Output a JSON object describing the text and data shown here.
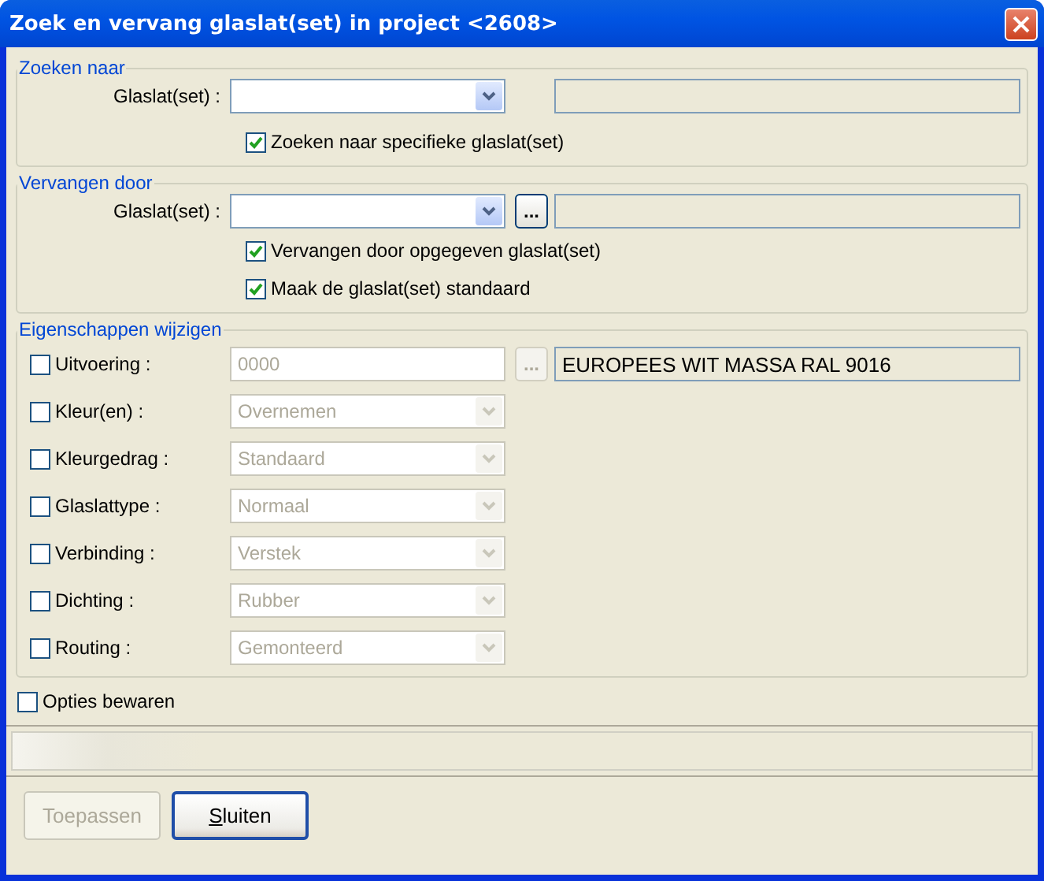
{
  "window": {
    "title": "Zoek en vervang glaslat(set) in project <2608>"
  },
  "search": {
    "legend": "Zoeken naar",
    "label": "Glaslat(set) :",
    "options": [
      {
        "label": "Zoeken naar specifieke glaslat(set)",
        "checked": true
      }
    ]
  },
  "replace": {
    "legend": "Vervangen door",
    "label": "Glaslat(set) :",
    "browse": "...",
    "options": [
      {
        "label": "Vervangen door opgegeven glaslat(set)",
        "checked": true
      },
      {
        "label": "Maak de glaslat(set) standaard",
        "checked": true
      }
    ]
  },
  "properties": {
    "legend": "Eigenschappen wijzigen",
    "rows": [
      {
        "kind": "text",
        "label": "Uitvoering :",
        "checked": false,
        "value": "0000",
        "browse": "...",
        "description": "EUROPEES WIT MASSA RAL 9016",
        "disabled": true
      },
      {
        "kind": "dropdown",
        "label": "Kleur(en) :",
        "checked": false,
        "value": "Overnemen",
        "disabled": true
      },
      {
        "kind": "dropdown",
        "label": "Kleurgedrag :",
        "checked": false,
        "value": "Standaard",
        "disabled": true
      },
      {
        "kind": "dropdown",
        "label": "Glaslattype :",
        "checked": false,
        "value": "Normaal",
        "disabled": true
      },
      {
        "kind": "dropdown",
        "label": "Verbinding :",
        "checked": false,
        "value": "Verstek",
        "disabled": true
      },
      {
        "kind": "dropdown",
        "label": "Dichting :",
        "checked": false,
        "value": "Rubber",
        "disabled": true
      },
      {
        "kind": "dropdown",
        "label": "Routing :",
        "checked": false,
        "value": "Gemonteerd",
        "disabled": true
      }
    ]
  },
  "save_options": {
    "label": "Opties bewaren",
    "checked": false
  },
  "buttons": [
    {
      "label": "Toepassen",
      "disabled": true,
      "default": false,
      "underline_first": false
    },
    {
      "label": "Sluiten",
      "disabled": false,
      "default": true,
      "underline_first": true
    }
  ]
}
